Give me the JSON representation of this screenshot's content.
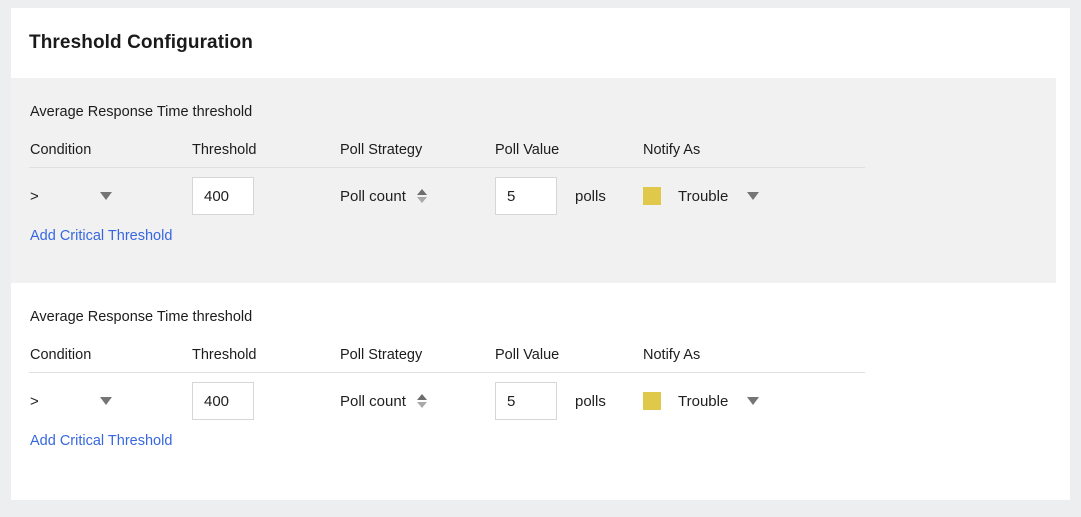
{
  "card": {
    "title": "Threshold Configuration"
  },
  "columns": {
    "condition": "Condition",
    "threshold": "Threshold",
    "poll_strategy": "Poll Strategy",
    "poll_value": "Poll Value",
    "notify_as": "Notify As"
  },
  "colors": {
    "trouble_swatch": "#e0c94a",
    "link": "#3767e0",
    "shaded_section_bg": "#f1f1f2",
    "page_bg": "#eceef0"
  },
  "sections": [
    {
      "title": "Average Response Time threshold",
      "condition_value": ">",
      "threshold_value": "400",
      "poll_strategy": "Poll count",
      "poll_value": "5",
      "poll_unit": "polls",
      "notify_as": "Trouble",
      "add_link": "Add Critical Threshold"
    },
    {
      "title": "Average Response Time threshold",
      "condition_value": ">",
      "threshold_value": "400",
      "poll_strategy": "Poll count",
      "poll_value": "5",
      "poll_unit": "polls",
      "notify_as": "Trouble",
      "add_link": "Add Critical Threshold"
    }
  ]
}
